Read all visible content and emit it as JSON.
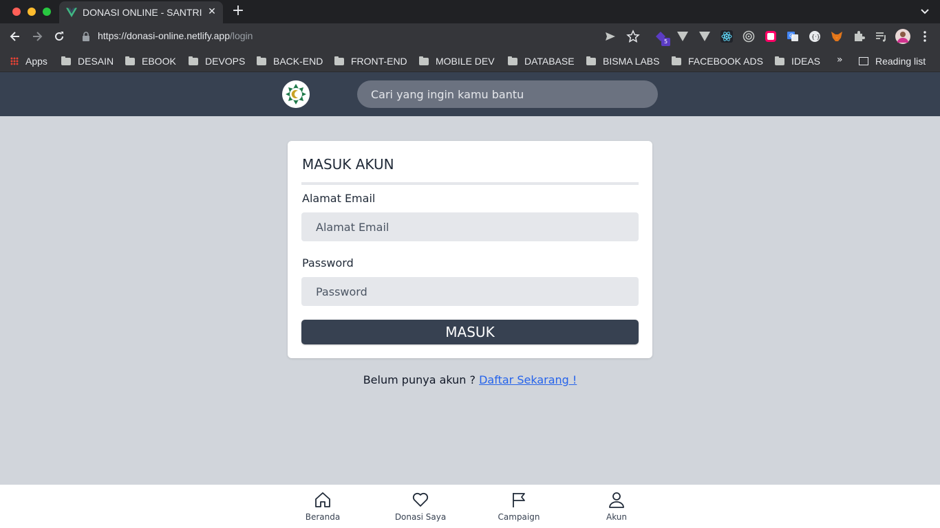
{
  "browser": {
    "tab_title": "DONASI ONLINE - SANTRI",
    "url_host": "https://donasi-online.netlify.app",
    "url_path": "/login",
    "extension_badge": "5",
    "bookmarks": [
      "Apps",
      "DESAIN",
      "EBOOK",
      "DEVOPS",
      "BACK-END",
      "FRONT-END",
      "MOBILE DEV",
      "DATABASE",
      "BISMA LABS",
      "FACEBOOK ADS",
      "IDEAS"
    ],
    "overflow": "»",
    "reading_list": "Reading list"
  },
  "header": {
    "search_placeholder": "Cari yang ingin kamu bantu"
  },
  "login": {
    "title": "MASUK AKUN",
    "email_label": "Alamat Email",
    "email_placeholder": "Alamat Email",
    "password_label": "Password",
    "password_placeholder": "Password",
    "submit_label": "MASUK",
    "signup_prompt": "Belum punya akun ?",
    "signup_link": "Daftar Sekarang !"
  },
  "bottom_nav": [
    {
      "label": "Beranda",
      "icon": "home-icon"
    },
    {
      "label": "Donasi Saya",
      "icon": "heart-icon"
    },
    {
      "label": "Campaign",
      "icon": "flag-icon"
    },
    {
      "label": "Akun",
      "icon": "user-icon"
    }
  ],
  "colors": {
    "header_bg": "#374151",
    "page_bg": "#d1d5db",
    "button_bg": "#374151",
    "link": "#2563eb"
  }
}
